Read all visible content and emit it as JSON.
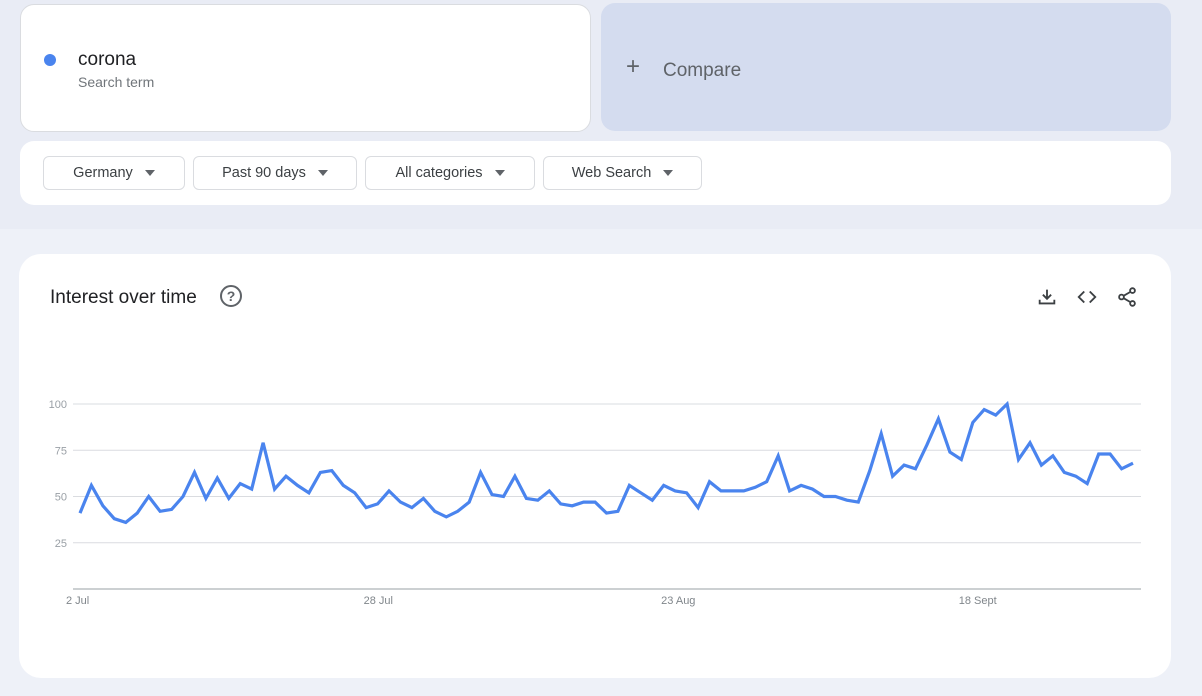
{
  "search_term": {
    "name": "corona",
    "subtitle": "Search term",
    "color": "#4a84ee"
  },
  "compare": {
    "icon": "plus-icon",
    "label": "Compare"
  },
  "filters": [
    {
      "label": "Germany",
      "icon": "caret-down-icon"
    },
    {
      "label": "Past 90 days",
      "icon": "caret-down-icon"
    },
    {
      "label": "All categories",
      "icon": "caret-down-icon"
    },
    {
      "label": "Web Search",
      "icon": "caret-down-icon"
    }
  ],
  "panel": {
    "title": "Interest over time",
    "help_icon": "question-circle-icon",
    "help_glyph": "?",
    "actions": [
      "download-icon",
      "embed-code-icon",
      "share-icon"
    ]
  },
  "chart_data": {
    "type": "line",
    "title": "Interest over time",
    "xlabel": "",
    "ylabel": "",
    "ylim": [
      0,
      100
    ],
    "yticks": [
      25,
      50,
      75,
      100
    ],
    "grid": true,
    "legend": "none",
    "x_tick_labels": [
      {
        "label": "2 Jul",
        "index": 0
      },
      {
        "label": "28 Jul",
        "index": 26
      },
      {
        "label": "23 Aug",
        "index": 52
      },
      {
        "label": "18 Sept",
        "index": 78
      }
    ],
    "series": [
      {
        "name": "corona",
        "color": "#4a84ee",
        "values": [
          41,
          56,
          45,
          38,
          36,
          41,
          50,
          42,
          43,
          50,
          63,
          49,
          60,
          49,
          57,
          54,
          79,
          54,
          61,
          56,
          52,
          63,
          64,
          56,
          52,
          44,
          46,
          53,
          47,
          44,
          49,
          42,
          39,
          42,
          47,
          63,
          51,
          50,
          61,
          49,
          48,
          53,
          46,
          45,
          47,
          47,
          41,
          42,
          56,
          52,
          48,
          56,
          53,
          52,
          44,
          58,
          53,
          53,
          53,
          55,
          58,
          72,
          53,
          56,
          54,
          50,
          50,
          48,
          47,
          64,
          84,
          61,
          67,
          65,
          78,
          92,
          74,
          70,
          90,
          97,
          94,
          100,
          70,
          79,
          67,
          72,
          63,
          61,
          57,
          73,
          73,
          65,
          68
        ]
      }
    ]
  }
}
